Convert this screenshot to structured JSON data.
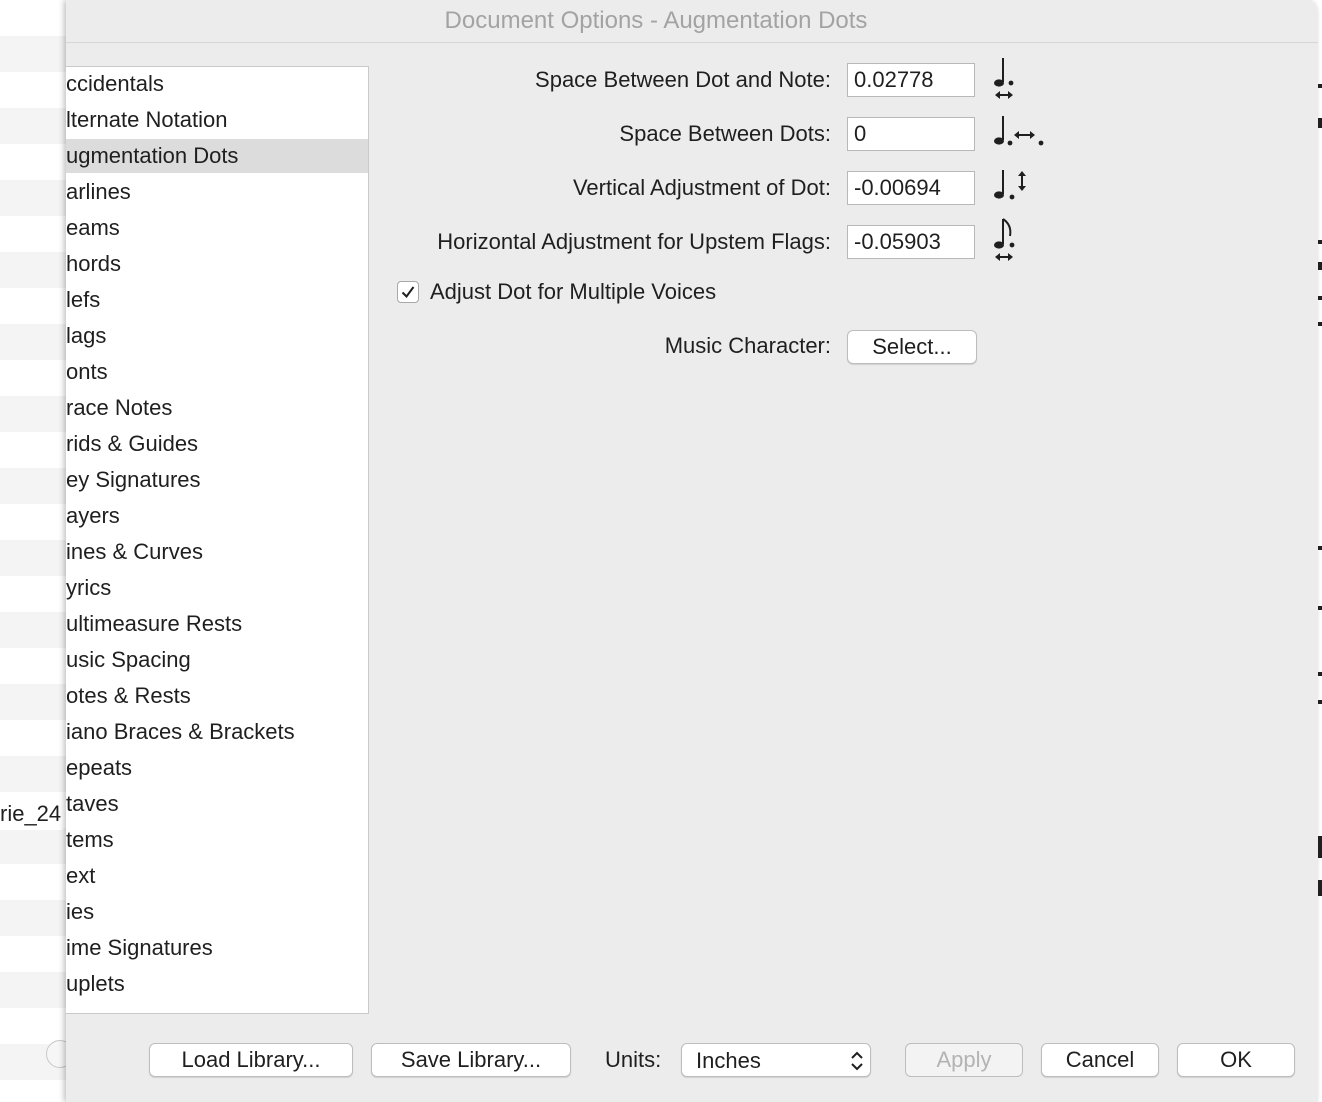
{
  "background_app": {
    "file_label": "rie_24"
  },
  "dialog": {
    "title": "Document Options - Augmentation Dots",
    "categories": [
      "ccidentals",
      "lternate Notation",
      "ugmentation Dots",
      "arlines",
      "eams",
      "hords",
      "lefs",
      "lags",
      "onts",
      "race Notes",
      "rids & Guides",
      "ey Signatures",
      "ayers",
      "ines & Curves",
      "yrics",
      "ultimeasure Rests",
      "usic Spacing",
      "otes & Rests",
      "iano Braces & Brackets",
      "epeats",
      "taves",
      "tems",
      "ext",
      "ies",
      "ime Signatures",
      "uplets"
    ],
    "selected_category_index": 2,
    "options": {
      "dot_note_space": {
        "label": "Space Between Dot and Note:",
        "value": "0.02778",
        "icon": "dot-note-space-icon"
      },
      "dots_space": {
        "label": "Space Between Dots:",
        "value": "0",
        "icon": "dots-space-icon"
      },
      "vertical_adjust": {
        "label": "Vertical Adjustment of Dot:",
        "value": "-0.00694",
        "icon": "vertical-adjust-icon"
      },
      "horizontal_adjust": {
        "label": "Horizontal Adjustment for Upstem Flags:",
        "value": "-0.05903",
        "icon": "upstem-flag-adjust-icon"
      }
    },
    "multiple_voices": {
      "label": "Adjust Dot for Multiple Voices",
      "checked": true
    },
    "music_character": {
      "label": "Music Character:",
      "button": "Select..."
    },
    "footer": {
      "load_library": "Load Library...",
      "save_library": "Save Library...",
      "units_label": "Units:",
      "units_value": "Inches",
      "apply": "Apply",
      "cancel": "Cancel",
      "ok": "OK"
    }
  },
  "colors": {
    "dialog_bg": "#ececec",
    "list_selected_bg": "#dcdcdc",
    "title_text": "#a3a3a3",
    "disabled_text": "#b3b3b3"
  }
}
